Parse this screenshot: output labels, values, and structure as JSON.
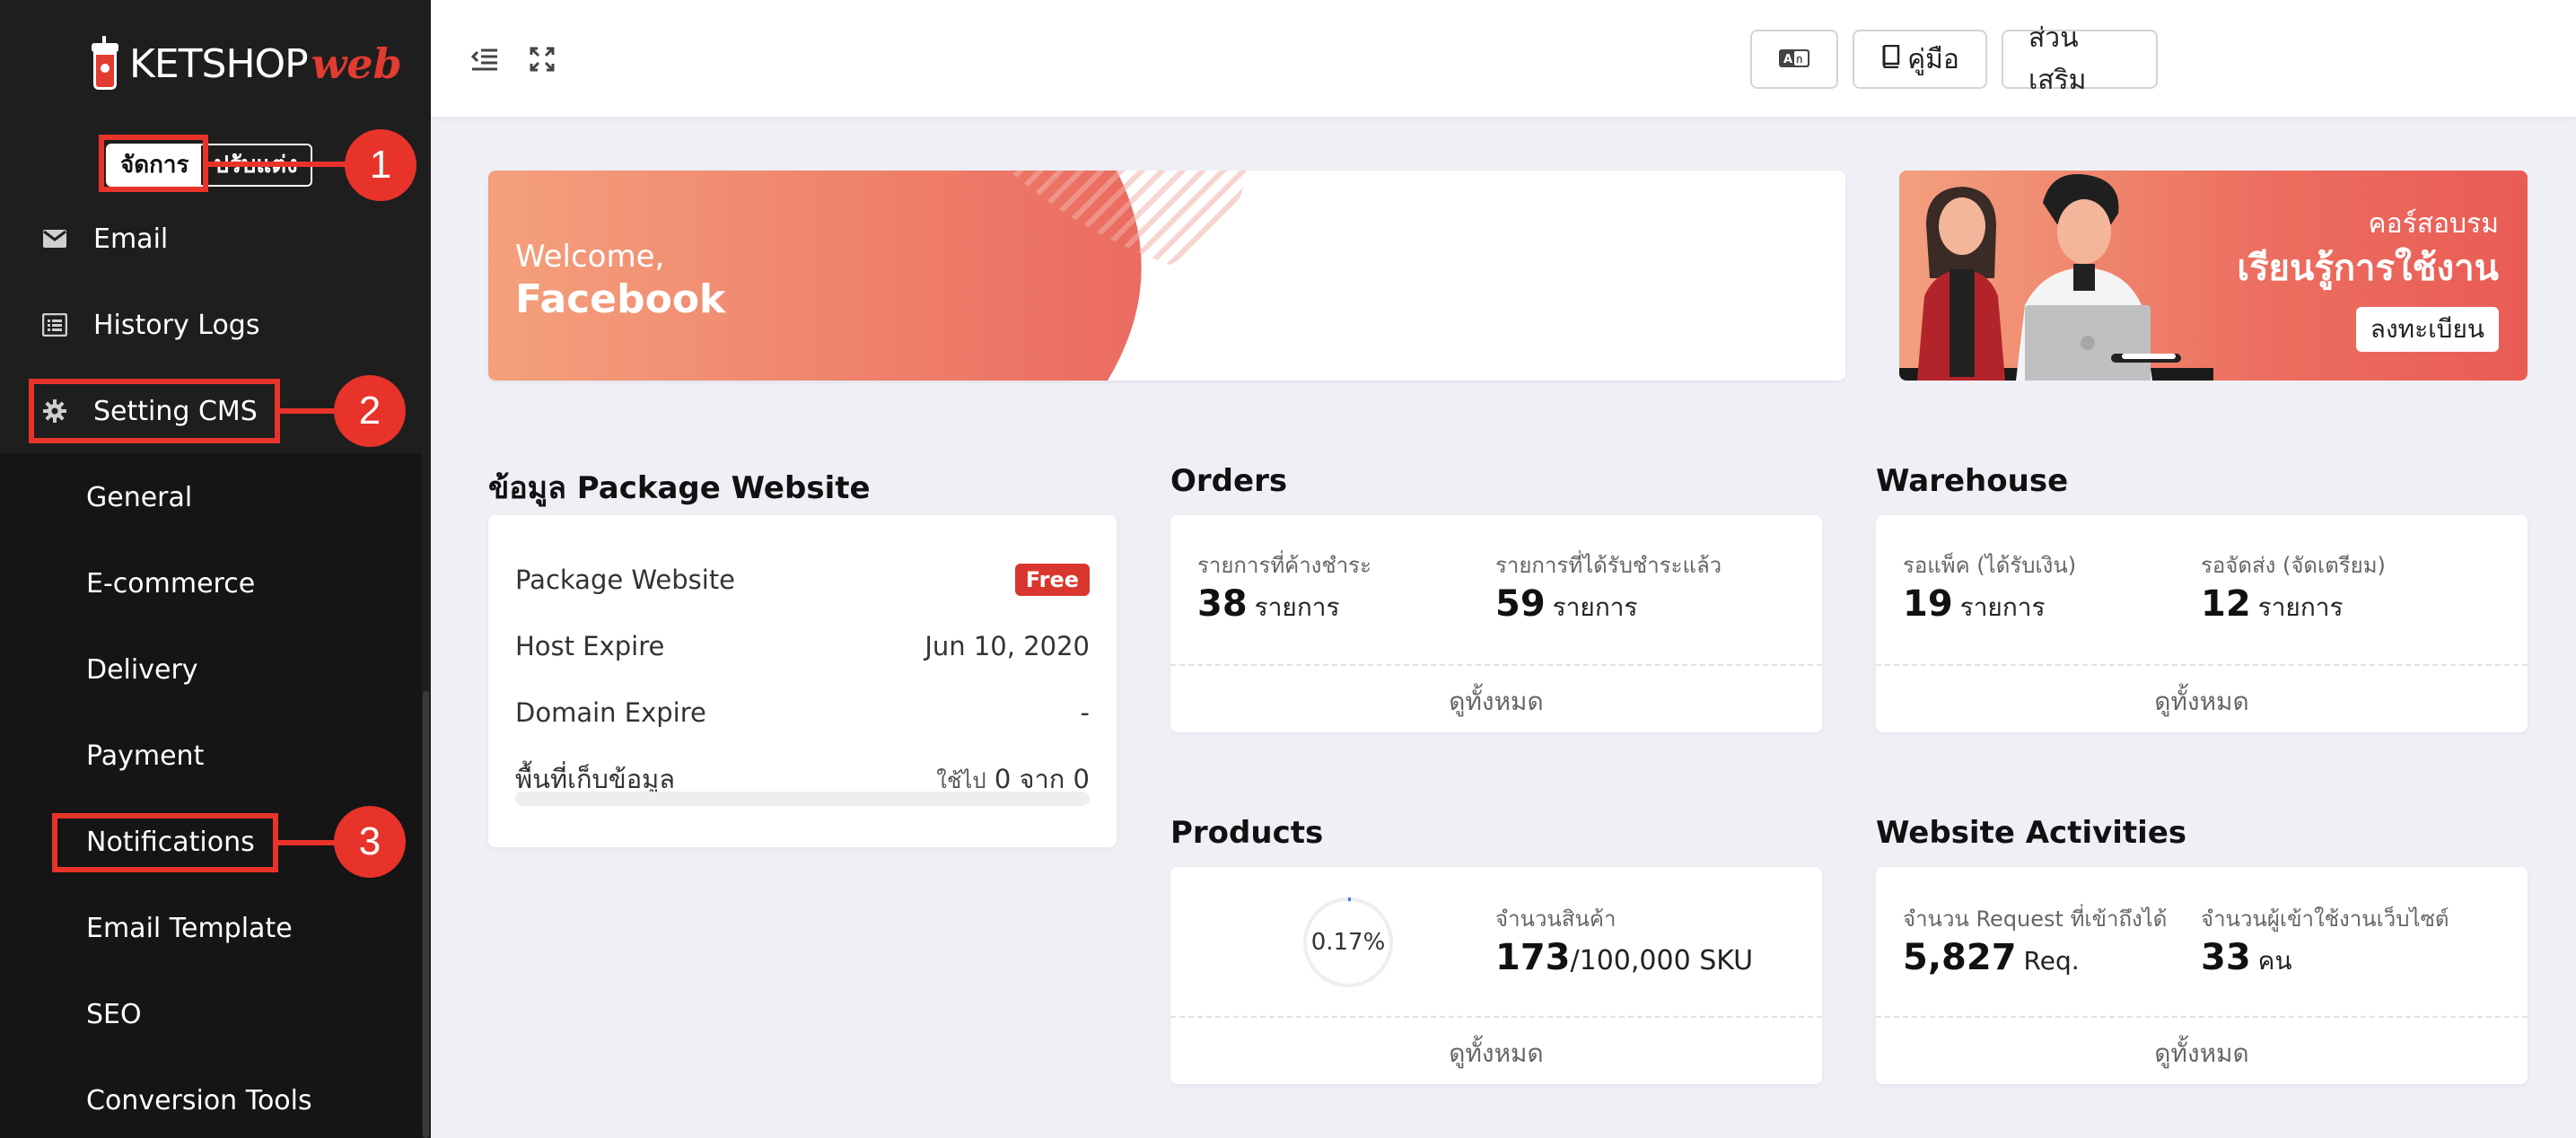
{
  "sidebar": {
    "brand": "KETSHOP",
    "brand_suffix": "web",
    "mode_active": "จัดการ",
    "mode_inactive": "ปรับแต่ง",
    "items": [
      {
        "label": "Email",
        "icon": "envelope-icon"
      },
      {
        "label": "History Logs",
        "icon": "list-icon"
      },
      {
        "label": "Setting CMS",
        "icon": "gear-icon"
      }
    ],
    "sub_items": [
      "General",
      "E-commerce",
      "Delivery",
      "Payment",
      "Notifications",
      "Email Template",
      "SEO",
      "Conversion Tools"
    ]
  },
  "annotations": [
    "1",
    "2",
    "3"
  ],
  "topbar": {
    "lang_button": "",
    "manual_label": "คู่มือ",
    "addons_label": "ส่วนเสริม"
  },
  "welcome": {
    "greeting": "Welcome,",
    "name": "Facebook"
  },
  "course": {
    "line1": "คอร์สอบรม",
    "line2": "เรียนรู้การใช้งาน",
    "register": "ลงทะเบียน"
  },
  "package": {
    "title": "ข้อมูล Package Website",
    "rows": [
      {
        "label": "Package Website",
        "value": "Free"
      },
      {
        "label": "Host Expire",
        "value": "Jun 10, 2020"
      },
      {
        "label": "Domain Expire",
        "value": "-"
      },
      {
        "label": "พื้นที่เก็บข้อมูล",
        "used_prefix": "ใช้ไป",
        "used": "0",
        "of": "จาก",
        "total": "0"
      }
    ],
    "storage_used_fraction": 0
  },
  "orders": {
    "title": "Orders",
    "pending_label": "รายการที่ค้างชำระ",
    "pending_value": "38",
    "paid_label": "รายการที่ได้รับชำระแล้ว",
    "paid_value": "59",
    "unit": "รายการ",
    "view_all": "ดูทั้งหมด"
  },
  "warehouse": {
    "title": "Warehouse",
    "pack_label": "รอแพ็ค (ได้รับเงิน)",
    "pack_value": "19",
    "ship_label": "รอจัดส่ง (จัดเตรียม)",
    "ship_value": "12",
    "unit": "รายการ",
    "view_all": "ดูทั้งหมด"
  },
  "products": {
    "title": "Products",
    "percent_label": "0.17%",
    "percent": 0.17,
    "count_label": "จำนวนสินค้า",
    "count": "173",
    "limit": "/100,000 SKU",
    "view_all": "ดูทั้งหมด"
  },
  "activities": {
    "title": "Website Activities",
    "requests_label": "จำนวน Request ที่เข้าถึงได้",
    "requests_value": "5,827",
    "requests_unit": "Req.",
    "visitors_label": "จำนวนผู้เข้าใช้งานเว็บไซต์",
    "visitors_value": "33",
    "visitors_unit": "คน",
    "view_all": "ดูทั้งหมด"
  },
  "colors": {
    "accent": "#e8332a",
    "sidebar": "#1e1e1e",
    "banner_start": "#f4a07c",
    "banner_end": "#eb6b60"
  }
}
